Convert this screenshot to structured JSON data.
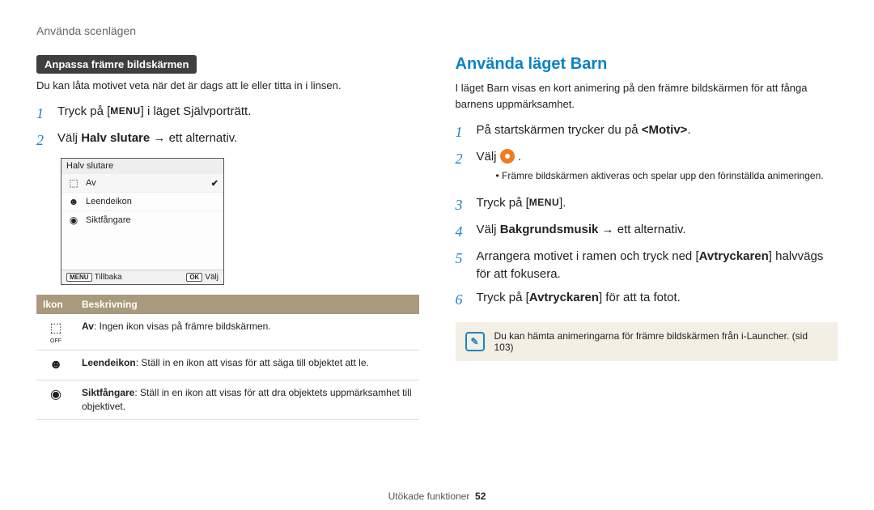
{
  "breadcrumb": "Använda scenlägen",
  "left": {
    "pill": "Anpassa främre bildskärmen",
    "intro": "Du kan låta motivet veta när det är dags att le eller titta in i linsen.",
    "step1_pre": "Tryck på [",
    "step1_menu": "MENU",
    "step1_post": "] i läget Självporträtt.",
    "step2_pre": "Välj ",
    "step2_bold": "Halv slutare",
    "step2_post": " → ett alternativ.",
    "lcd": {
      "title": "Halv slutare",
      "opt1": "Av",
      "opt2": "Leendeikon",
      "opt3": "Siktfångare",
      "back_key": "MENU",
      "back_label": "Tillbaka",
      "ok_key": "OK",
      "ok_label": "Välj"
    },
    "table": {
      "h1": "Ikon",
      "h2": "Beskrivning",
      "r1b": "Av",
      "r1t": ": Ingen ikon visas på främre bildskärmen.",
      "r2b": "Leendeikon",
      "r2t": ": Ställ in en ikon att visas för att säga till objektet att le.",
      "r3b": "Siktfångare",
      "r3t": ": Ställ in en ikon att visas för att dra objektets uppmärksamhet till objektivet."
    }
  },
  "right": {
    "title": "Använda läget Barn",
    "intro": "I läget Barn visas en kort animering på den främre bildskärmen för att fånga barnens uppmärksamhet.",
    "s1_pre": "På startskärmen trycker du på ",
    "s1_bold": "<Motiv>",
    "s1_post": ".",
    "s2": "Välj ",
    "s2_bullet": "Främre bildskärmen aktiveras och spelar upp den förinställda animeringen.",
    "s3_pre": "Tryck på [",
    "s3_menu": "MENU",
    "s3_post": "].",
    "s4_pre": "Välj ",
    "s4_bold": "Bakgrundsmusik",
    "s4_post": " → ett alternativ.",
    "s5_pre": "Arrangera motivet i ramen och tryck ned [",
    "s5_bold": "Avtryckaren",
    "s5_post": "] halvvägs för att fokusera.",
    "s6_pre": "Tryck på [",
    "s6_bold": "Avtryckaren",
    "s6_post": "] för att ta fotot.",
    "note": "Du kan hämta animeringarna för främre bildskärmen från i-Launcher. (sid 103)"
  },
  "footer": {
    "label": "Utökade funktioner",
    "page": "52"
  }
}
